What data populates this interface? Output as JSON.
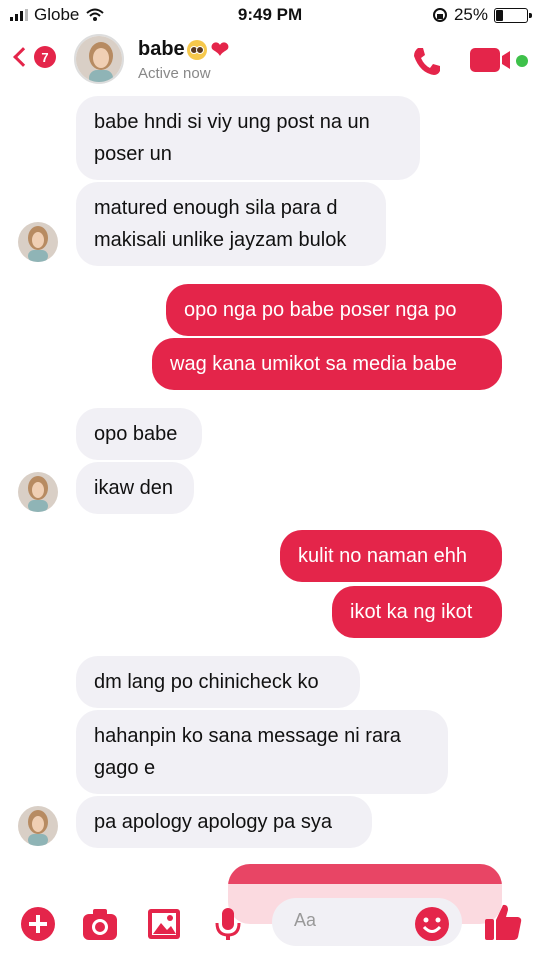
{
  "status_bar": {
    "carrier": "Globe",
    "time": "9:49 PM",
    "battery": "25%"
  },
  "header": {
    "back_count": "7",
    "contact_name": "babe",
    "active_status": "Active now"
  },
  "messages": [
    {
      "from": "them",
      "text": "babe hndi si viy ung post na un poser un"
    },
    {
      "from": "them",
      "text": "matured enough sila para d makisali unlike jayzam bulok"
    },
    {
      "from": "me",
      "text": "opo nga po babe poser nga po"
    },
    {
      "from": "me",
      "text": "wag kana umikot sa media babe"
    },
    {
      "from": "them",
      "text": "opo babe"
    },
    {
      "from": "them",
      "text": "ikaw den"
    },
    {
      "from": "me",
      "text": "kulit no naman ehh"
    },
    {
      "from": "me",
      "text": "ikot ka ng ikot"
    },
    {
      "from": "them",
      "text": "dm lang po chinicheck ko"
    },
    {
      "from": "them",
      "text": "hahanpin ko sana message ni rara gago e"
    },
    {
      "from": "them",
      "text": "pa apology apology pa sya"
    }
  ],
  "composer": {
    "placeholder": "Aa",
    "icons": [
      "plus-icon",
      "camera-icon",
      "image-icon",
      "microphone-icon",
      "emoji-icon",
      "like-icon"
    ]
  },
  "colors": {
    "accent": "#e4254a",
    "received_bubble": "#f1f0f5",
    "online": "#3ec14a"
  }
}
